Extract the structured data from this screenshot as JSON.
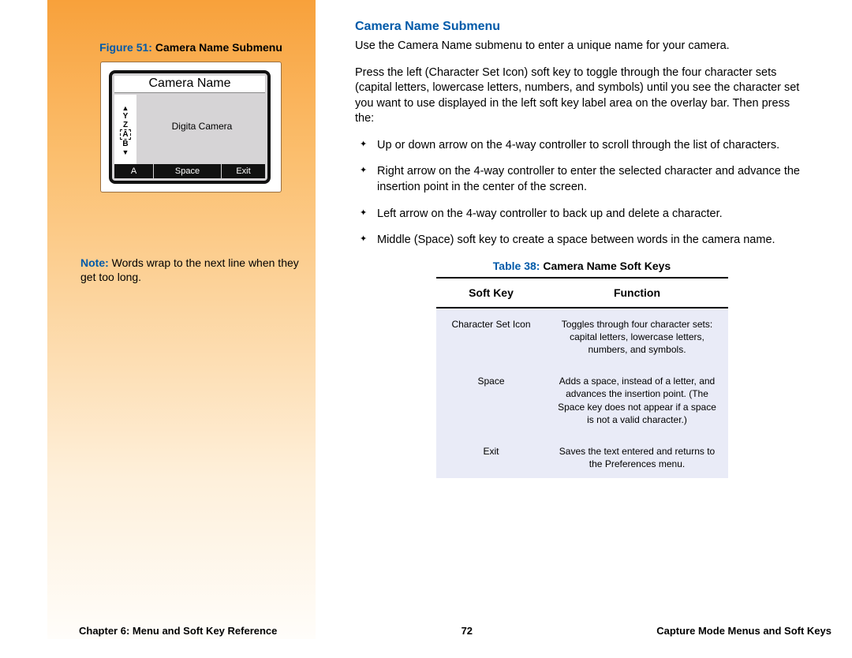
{
  "sidebar": {
    "figure_label": "Figure 51:",
    "figure_title": " Camera Name Submenu",
    "camera": {
      "title": "Camera Name",
      "scroll_chars": [
        "Y",
        "Z",
        "A",
        "B"
      ],
      "current_text": "Digita Camera",
      "bar": {
        "left": "A",
        "mid": "Space",
        "right": "Exit"
      }
    },
    "note_label": "Note:",
    "note_text": " Words wrap to the next line when they get too long."
  },
  "main": {
    "heading": "Camera Name Submenu",
    "p1": "Use the Camera Name submenu to enter a unique name for your camera.",
    "p2": "Press the left (Character Set Icon) soft key to toggle through the four character sets (capital letters, lowercase letters, numbers, and symbols) until you see the character set you want to use displayed in the left soft key label area on the overlay bar. Then press the:",
    "bullets": [
      "Up or down arrow on the 4-way controller to scroll through the list of characters.",
      "Right arrow on the 4-way controller to enter the selected character and advance the insertion point in the center of the screen.",
      "Left arrow on the 4-way controller to back up and delete a character.",
      "Middle (Space) soft key to create a space between words in the camera name."
    ],
    "table_label": "Table 38:",
    "table_title": " Camera Name Soft Keys",
    "table_head": {
      "c1": "Soft Key",
      "c2": "Function"
    },
    "table_rows": [
      {
        "k": "Character Set Icon",
        "v": "Toggles through four character sets: capital letters, lowercase letters, numbers, and symbols."
      },
      {
        "k": "Space",
        "v": "Adds a space, instead of a letter, and advances the insertion point. (The Space key does not appear if a space is not a valid character.)"
      },
      {
        "k": "Exit",
        "v": "Saves the text entered and returns to the Preferences menu."
      }
    ]
  },
  "footer": {
    "left": "Chapter 6: Menu and Soft Key Reference",
    "center": "72",
    "right": "Capture Mode Menus and Soft Keys"
  }
}
